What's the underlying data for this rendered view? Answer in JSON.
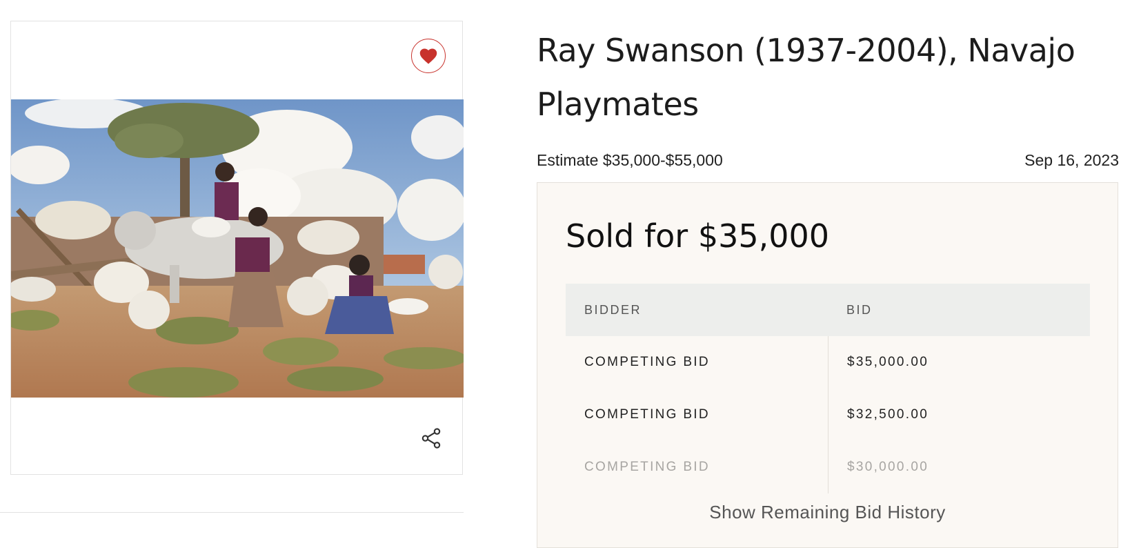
{
  "lot": {
    "title": "Ray Swanson (1937-2004), Navajo Playmates",
    "estimate": "Estimate $35,000-$55,000",
    "date": "Sep 16, 2023"
  },
  "image_card": {
    "favorite_icon": "heart-icon",
    "share_icon": "share-icon",
    "favorite_color": "#c8322c"
  },
  "bids": {
    "sold_text": "Sold for $35,000",
    "headers": {
      "bidder": "BIDDER",
      "bid": "BID"
    },
    "rows": [
      {
        "bidder": "COMPETING BID",
        "bid": "$35,000.00"
      },
      {
        "bidder": "COMPETING BID",
        "bid": "$32,500.00"
      },
      {
        "bidder": "COMPETING BID",
        "bid": "$30,000.00"
      }
    ],
    "show_more": "Show Remaining Bid History"
  }
}
